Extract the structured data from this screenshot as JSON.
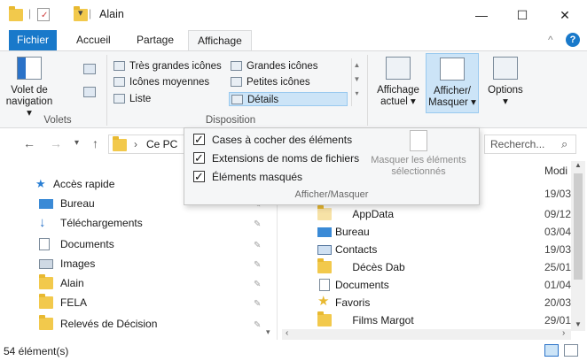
{
  "window": {
    "title": "Alain",
    "minimize_glyph": "—",
    "maximize_glyph": "☐",
    "close_glyph": "✕",
    "qat_arrow": "▾",
    "separator": "|"
  },
  "menu_tabs": {
    "file": "Fichier",
    "home": "Accueil",
    "share": "Partage",
    "view": "Affichage",
    "collapse_glyph": "^",
    "help_glyph": "?"
  },
  "ribbon": {
    "panes": {
      "nav_pane_label": "Volet de navigation",
      "nav_pane_arrow": "▾",
      "group_label": "Volets"
    },
    "layout": {
      "items": [
        "Très grandes icônes",
        "Grandes icônes",
        "Icônes moyennes",
        "Petites icônes",
        "Liste",
        "Détails"
      ],
      "group_label": "Disposition"
    },
    "current_view_label": "Affichage actuel",
    "show_hide_label": "Afficher/ Masquer",
    "options_label": "Options",
    "arrow": "▾"
  },
  "address": {
    "back": "←",
    "forward": "→",
    "recent": "▾",
    "up": "↑",
    "path": "Ce PC",
    "chevron": "›",
    "search_placeholder": "Recherch...",
    "search_icon_glyph": "⌕"
  },
  "dropdown": {
    "checkboxes": [
      {
        "label": "Cases à cocher des éléments",
        "checked": true
      },
      {
        "label": "Extensions de noms de fichiers",
        "checked": true
      },
      {
        "label": "Éléments masqués",
        "checked": true
      }
    ],
    "hide_selected_label": "Masquer les éléments sélectionnés",
    "group_label": "Afficher/Masquer"
  },
  "nav_pane": {
    "quick_access": "Accès rapide",
    "items": [
      {
        "label": "Bureau",
        "icon": "desktop-icon",
        "pinned": true
      },
      {
        "label": "Téléchargements",
        "icon": "download-icon",
        "pinned": true
      },
      {
        "label": "Documents",
        "icon": "document-icon",
        "pinned": true
      },
      {
        "label": "Images",
        "icon": "images-icon",
        "pinned": true
      },
      {
        "label": "Alain",
        "icon": "folder-icon",
        "pinned": true
      },
      {
        "label": "FELA",
        "icon": "folder-icon",
        "pinned": true
      },
      {
        "label": "Relevés de Décision",
        "icon": "folder-icon",
        "pinned": true
      }
    ],
    "pin_glyph": "✎"
  },
  "file_pane": {
    "date_header": "Modi",
    "files": [
      {
        "name": "AppData",
        "icon": "folder-faded-icon",
        "date": "09/12"
      },
      {
        "name": "Bureau",
        "icon": "desktop-icon",
        "date": "03/04"
      },
      {
        "name": "Contacts",
        "icon": "contacts-icon",
        "date": "19/03"
      },
      {
        "name": "Décès Dab",
        "icon": "folder-icon",
        "date": "25/01"
      },
      {
        "name": "Documents",
        "icon": "document-icon",
        "date": "01/04"
      },
      {
        "name": "Favoris",
        "icon": "star-icon",
        "date": "20/03"
      },
      {
        "name": "Films Margot",
        "icon": "folder-icon",
        "date": "29/01"
      }
    ],
    "first_date": "19/03"
  },
  "status": {
    "count": "54 élément(s)"
  },
  "colors": {
    "accent": "#1979ca",
    "folder": "#f2c94c",
    "ribbon_bg": "#f5f6f7",
    "selected": "#cce4f7",
    "help": "#1979ca"
  }
}
